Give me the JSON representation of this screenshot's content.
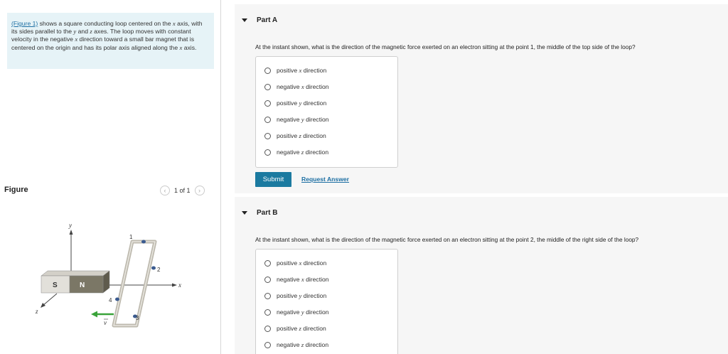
{
  "intro": {
    "link_text": "(Figure 1)",
    "text_1": " shows a square conducting loop centered on the ",
    "var_x1": "x",
    "text_2": " axis, with its sides parallel to the ",
    "var_y": "y",
    "text_3": " and ",
    "var_z": "z",
    "text_4": " axes. The loop moves with constant velocity in the negative ",
    "var_x2": "x",
    "text_5": " direction toward a small bar magnet that is centered on the origin and has its polar axis aligned along the ",
    "var_x3": "x",
    "text_6": " axis."
  },
  "figure": {
    "label": "Figure",
    "pager_text": "1 of 1",
    "prev_icon": "chevron-left-icon",
    "next_icon": "chevron-right-icon",
    "axis_y": "y",
    "axis_x": "x",
    "axis_z": "z",
    "magnet_s": "S",
    "magnet_n": "N",
    "point_1": "1",
    "point_2": "2",
    "point_3": "3",
    "point_4": "4",
    "velocity_label": "v",
    "colors": {
      "loop": "#c9c6bc",
      "magnet_s": "#e2e0da",
      "magnet_n": "#7b7766",
      "velocity_arrow": "#3aa33a",
      "marker": "#3b5b8f"
    }
  },
  "partA": {
    "title": "Part A",
    "question": "At the instant shown, what is the direction of the magnetic force exerted on an electron sitting at the point 1, the middle of the top side of the loop?",
    "choices": [
      {
        "pre": "positive ",
        "var": "x",
        "post": " direction"
      },
      {
        "pre": "negative ",
        "var": "x",
        "post": " direction"
      },
      {
        "pre": "positive ",
        "var": "y",
        "post": " direction"
      },
      {
        "pre": "negative ",
        "var": "y",
        "post": " direction"
      },
      {
        "pre": "positive ",
        "var": "z",
        "post": " direction"
      },
      {
        "pre": "negative ",
        "var": "z",
        "post": " direction"
      }
    ],
    "submit_label": "Submit",
    "request_label": "Request Answer"
  },
  "partB": {
    "title": "Part B",
    "question": "At the instant shown, what is the direction of the magnetic force exerted on an electron sitting at the point 2, the middle of the right side of the loop?",
    "choices": [
      {
        "pre": "positive ",
        "var": "x",
        "post": " direction"
      },
      {
        "pre": "negative ",
        "var": "x",
        "post": " direction"
      },
      {
        "pre": "positive ",
        "var": "y",
        "post": " direction"
      },
      {
        "pre": "negative ",
        "var": "y",
        "post": " direction"
      },
      {
        "pre": "positive ",
        "var": "z",
        "post": " direction"
      },
      {
        "pre": "negative ",
        "var": "z",
        "post": " direction"
      }
    ]
  },
  "colors": {
    "accent": "#1b7aa0",
    "intro_bg": "#e6f3f7",
    "part_bg": "#f6f6f6",
    "link": "#1d6fa3"
  }
}
